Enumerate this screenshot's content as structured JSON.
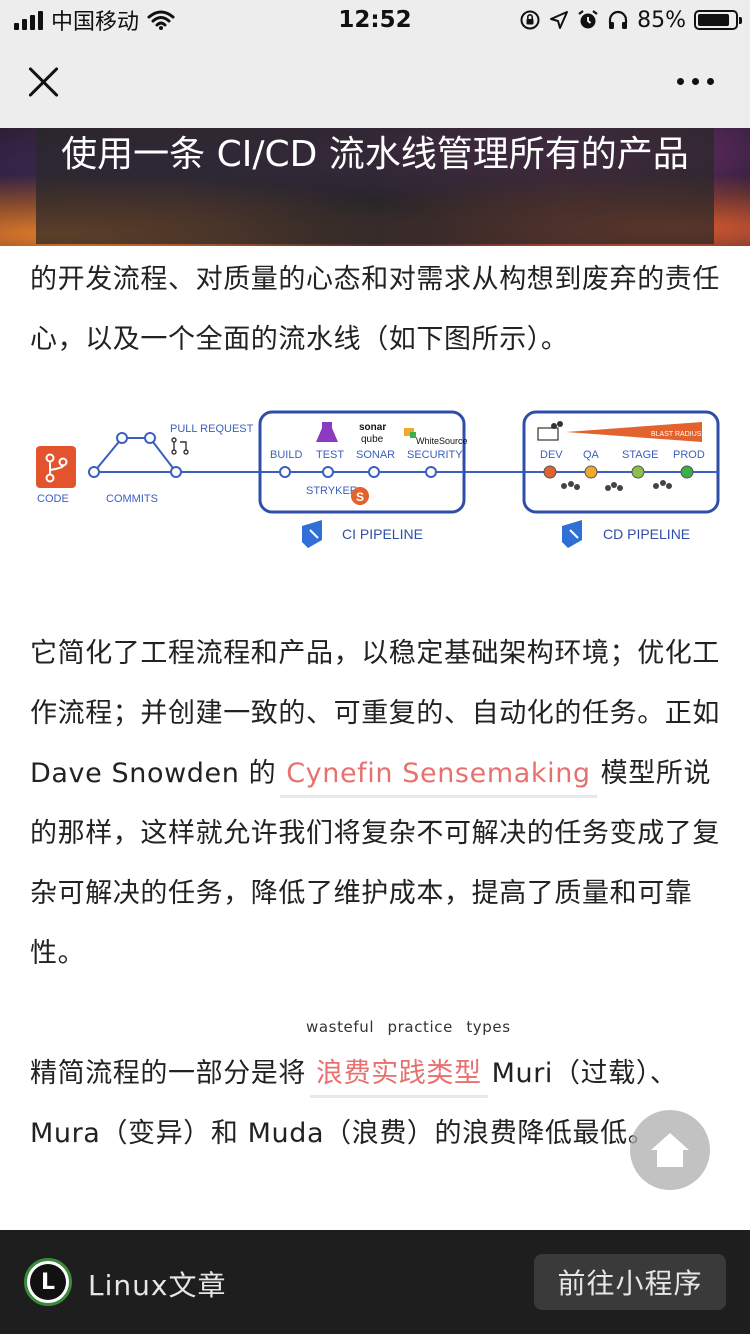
{
  "status_bar": {
    "carrier": "中国移动",
    "time": "12:52",
    "battery_percent": "85%",
    "battery_level": 0.85
  },
  "article": {
    "title": "使用一条 CI/CD 流水线管理所有的产品",
    "para1": "的开发流程、对质量的心态和对需求从构想到废弃的责任心，以及一个全面的流水线（如下图所示）。",
    "diagram": {
      "labels": {
        "code": "CODE",
        "commits": "COMMITS",
        "pull_request": "PULL REQUEST",
        "build": "BUILD",
        "test": "TEST",
        "sonar": "SONAR",
        "security": "SECURITY",
        "stryker": "STRYKER",
        "sonar_logo_top": "sonar",
        "sonar_logo_bottom": "qube",
        "whitesource": "WhiteSource",
        "blast_radius": "BLAST RADIUS",
        "dev": "DEV",
        "qa": "QA",
        "stage": "STAGE",
        "prod": "PROD",
        "ci_pipeline": "CI PIPELINE",
        "cd_pipeline": "CD PIPELINE"
      },
      "colors": {
        "line": "#3a5fbf",
        "box": "#2f4ea8",
        "code": "#e2532e",
        "dev": "#e2632e",
        "qa": "#f0a92a",
        "stage": "#8cc04a",
        "prod": "#3cae4a"
      }
    },
    "para2_part1": "它简化了工程流程和产品，以稳定基础架构环境；优化工作流程；并创建一致的、可重复的、自动化的任务。正如 Dave Snowden 的",
    "para2_link": "Cynefin Sensemaking",
    "para2_part2": "模型所说的那样，这样就允许我们将复杂不可解决的任务变成了复杂可解决的任务，降低了维护成本，提高了质量和可靠性。",
    "para3_part1": "精简流程的一部分是将",
    "para3_ruby": "wasteful practice types",
    "para3_link": "浪费实践类型",
    "para3_part2": "Muri（过载）、Mura（变异）和 Muda（浪费）的浪费降低最低。"
  },
  "bottom_bar": {
    "logo_letter": "L",
    "app_name": "Linux文章",
    "mini_program_button": "前往小程序"
  }
}
